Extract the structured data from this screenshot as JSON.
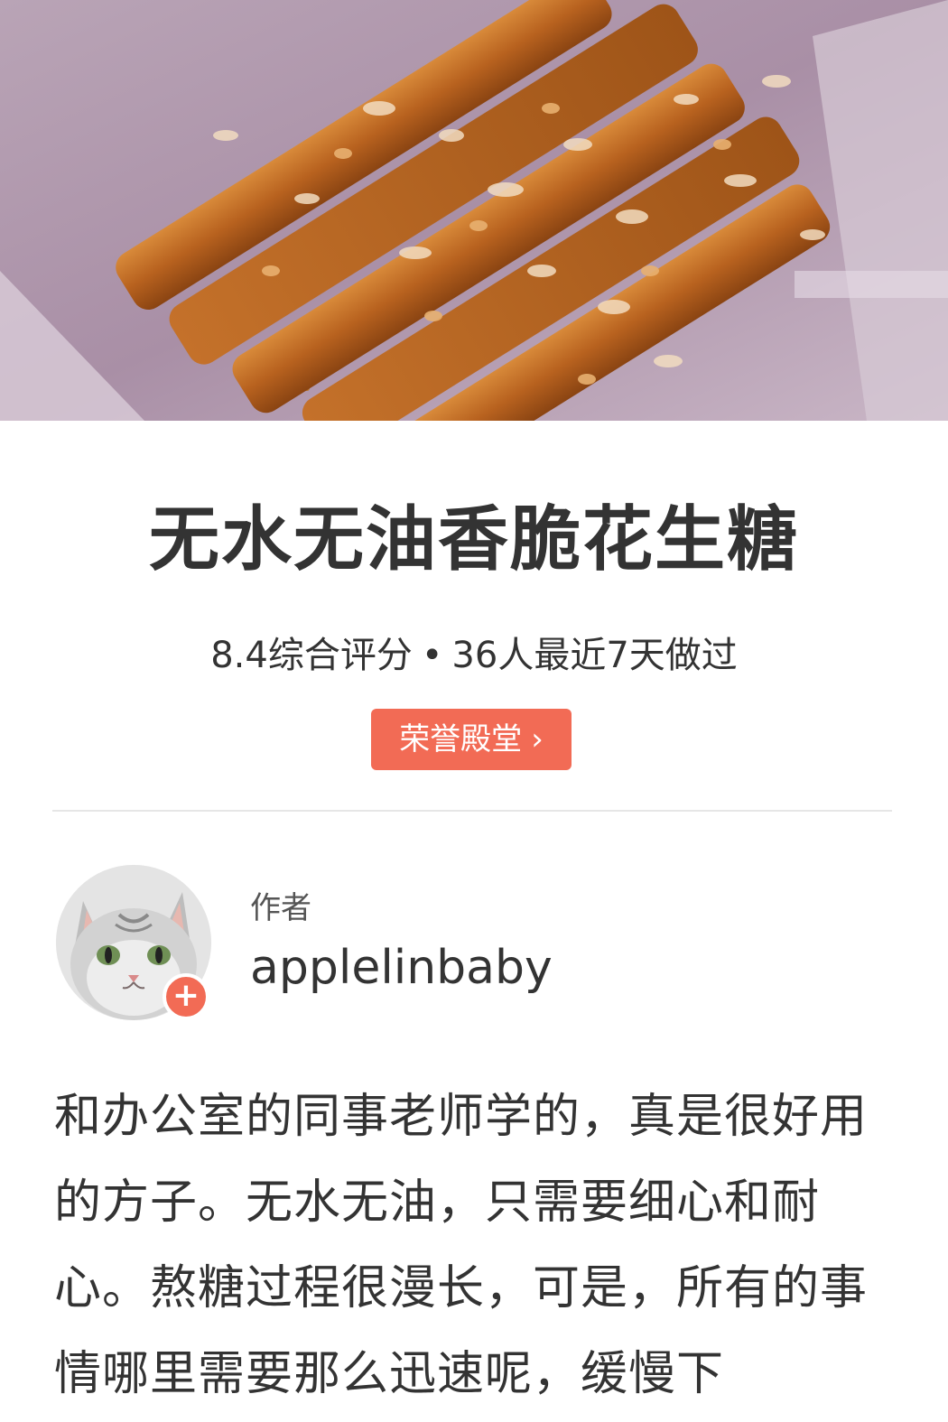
{
  "recipe": {
    "title": "无水无油香脆花生糖",
    "rating_text": "8.4综合评分",
    "dot": "•",
    "made_text": "36人最近7天做过",
    "honor_label": "荣誉殿堂",
    "honor_chevron": "›"
  },
  "author": {
    "label": "作者",
    "name": "applelinbaby",
    "follow_symbol": "+"
  },
  "description": "和办公室的同事老师学的，真是很好用的方子。无水无油，只需要细心和耐心。熬糖过程很漫长，可是，所有的事情哪里需要那么迅速呢，缓慢下",
  "icons": {
    "honor_chevron": "chevron-right-icon",
    "follow": "plus-icon"
  },
  "colors": {
    "accent": "#f26b55",
    "text": "#333333",
    "divider": "#e6e6e6"
  }
}
